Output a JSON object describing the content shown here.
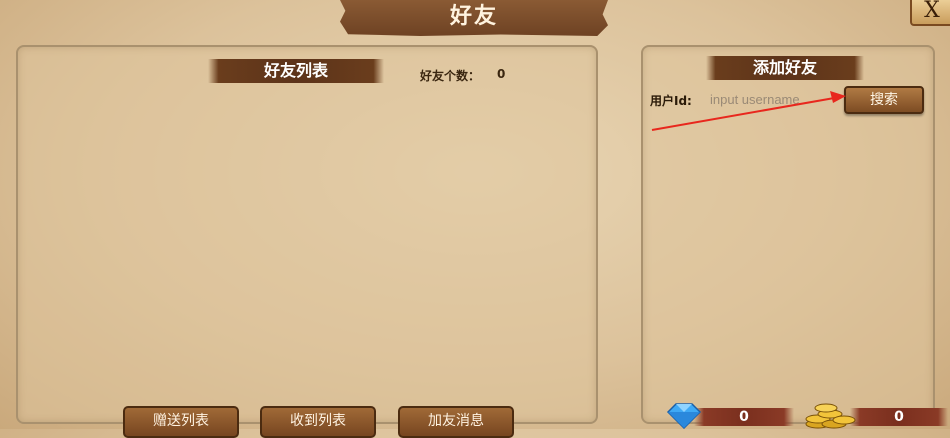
{
  "window": {
    "title": "好友",
    "close_label": "X"
  },
  "friends_panel": {
    "header": "好友列表",
    "count_label": "好友个数：",
    "count_value": "0"
  },
  "add_panel": {
    "header": "添加好友",
    "uid_label": "用户Id:",
    "uid_placeholder": "input username",
    "search_label": "搜索"
  },
  "tabs": [
    {
      "label": "赠送列表"
    },
    {
      "label": "收到列表"
    },
    {
      "label": "加友消息"
    }
  ],
  "currency": {
    "gems": "0",
    "gold": "0"
  },
  "icons": {
    "gem": "gem-icon",
    "gold": "gold-coins-icon",
    "arrow": "red-arrow-annotation"
  },
  "colors": {
    "arrow": "#e8271d",
    "button_brown": "#7d4c23",
    "panel_border": "#a9916e"
  }
}
